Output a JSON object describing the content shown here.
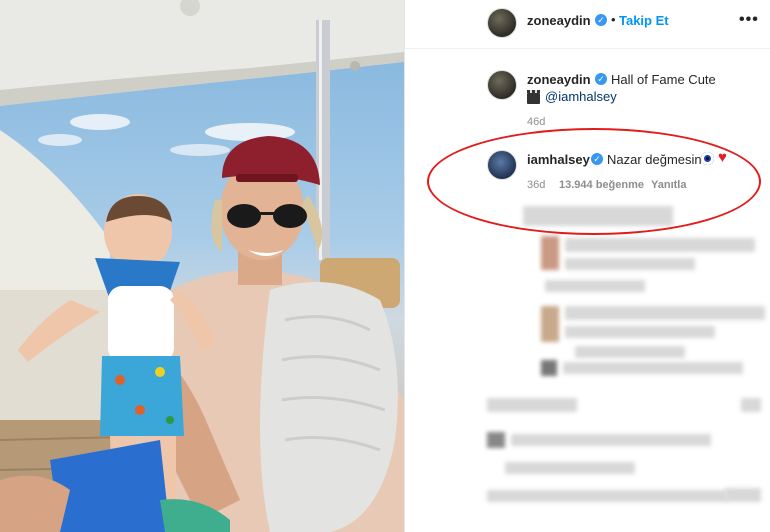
{
  "post": {
    "author": "zoneaydin",
    "follow_label": "Takip Et",
    "more_label": "•••"
  },
  "caption": {
    "author": "zoneaydin",
    "text": "Hall of Fame Cute",
    "mention": "@iamhalsey",
    "time": "46d"
  },
  "comment": {
    "author": "iamhalsey",
    "text": "Nazar değmesin",
    "time": "36d",
    "likes": "13.944 beğenme",
    "reply_label": "Yanıtla"
  },
  "icons": {
    "verified": "verified-badge-icon",
    "more": "more-options-icon",
    "clapper": "clapperboard-icon",
    "nazar": "nazar-eye-icon",
    "heart": "red-heart-icon"
  },
  "colors": {
    "follow": "#0095f6",
    "verified": "#3897f0",
    "highlight": "#e21b1b",
    "meta": "#8e8e8e"
  }
}
